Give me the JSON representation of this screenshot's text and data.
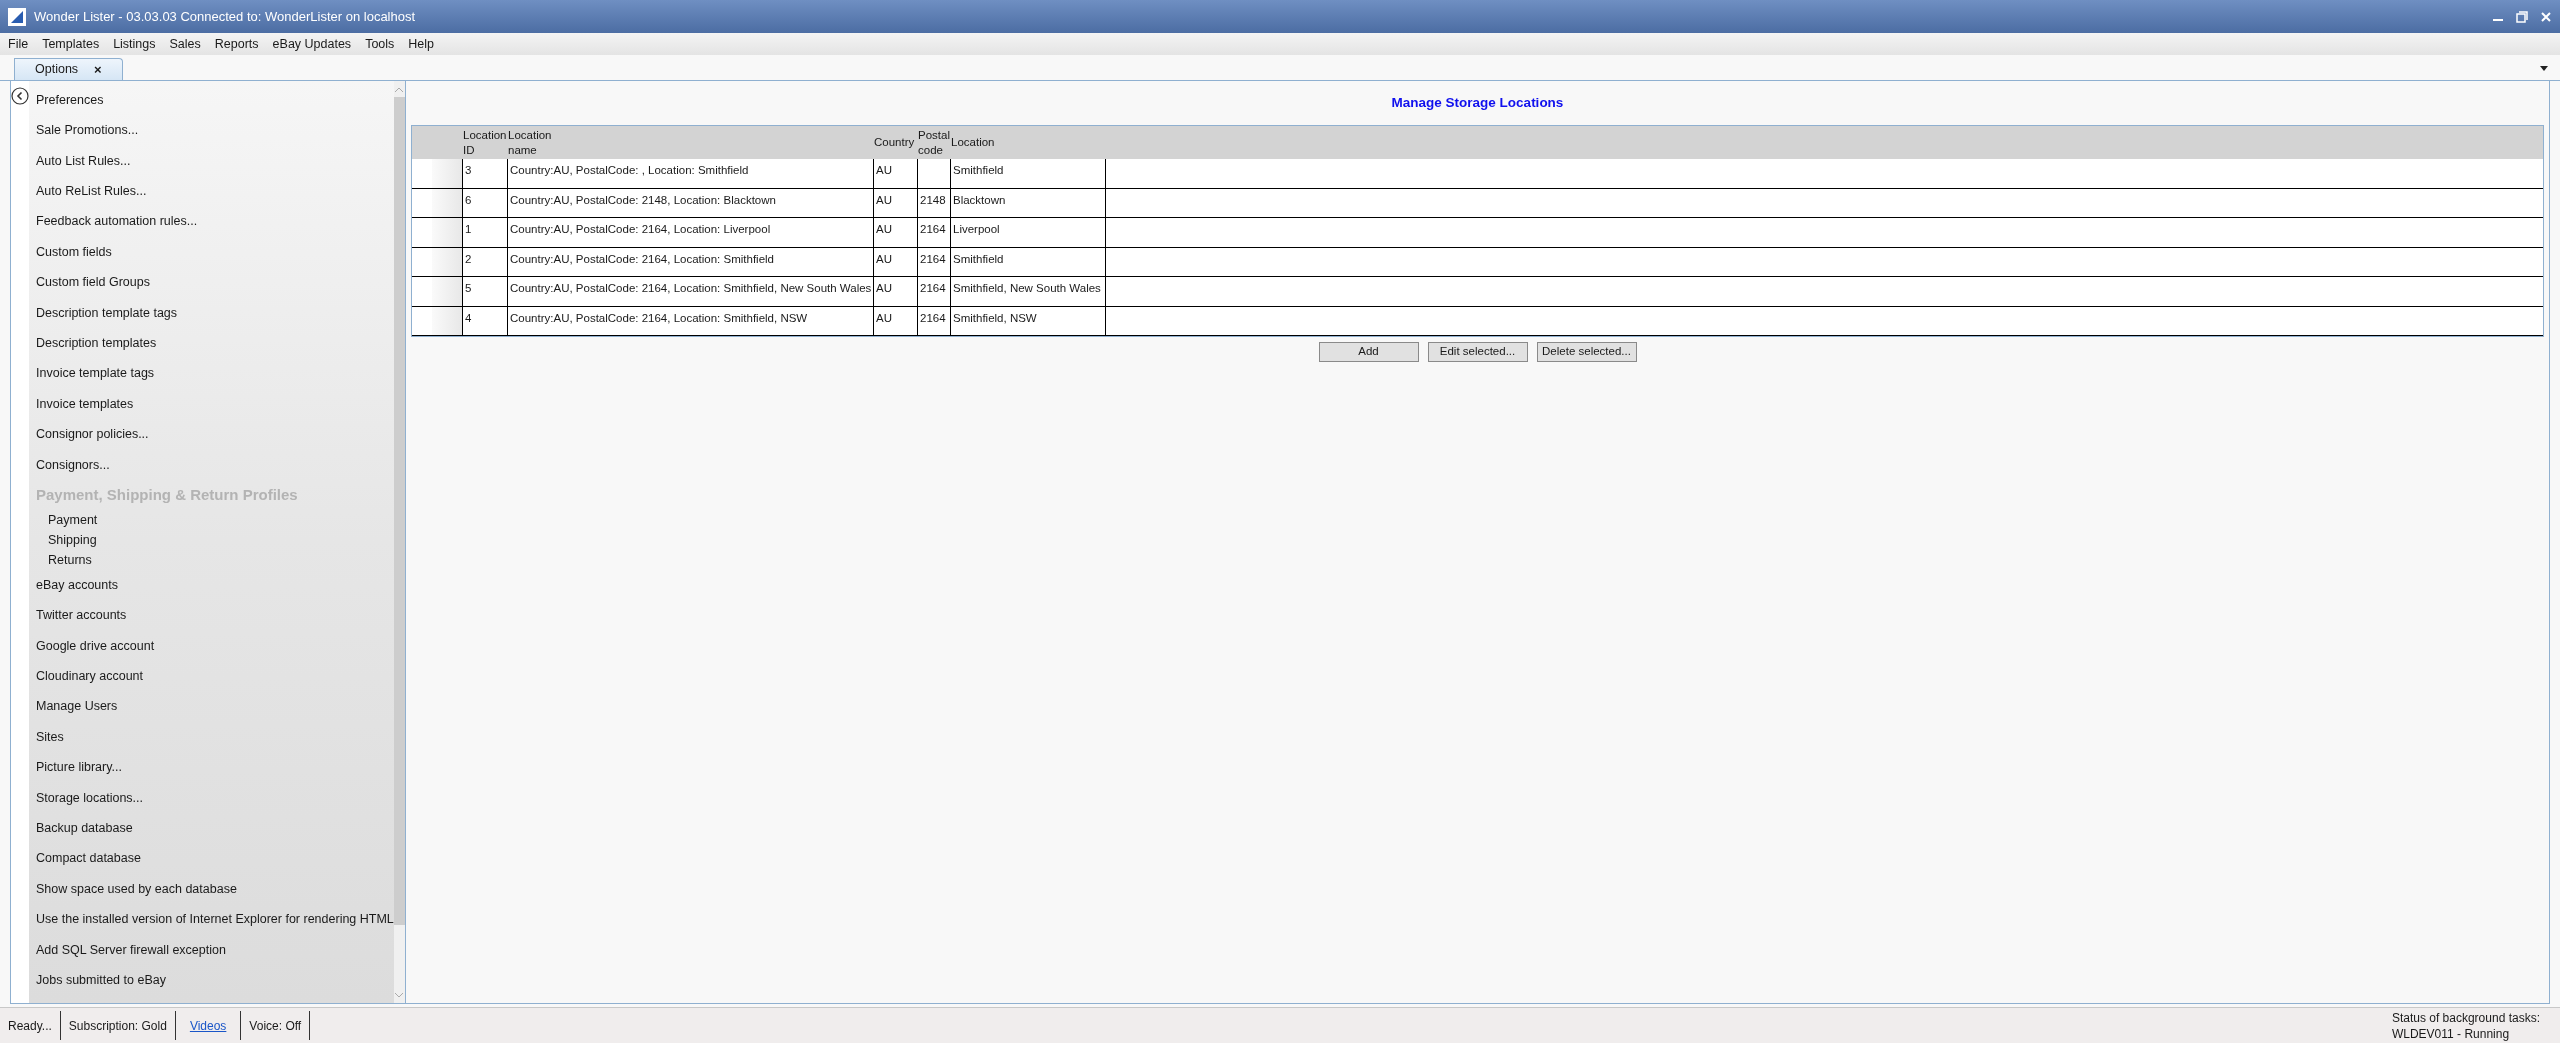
{
  "window": {
    "title": "Wonder Lister - 03.03.03 Connected to: WonderLister on localhost"
  },
  "menu": [
    "File",
    "Templates",
    "Listings",
    "Sales",
    "Reports",
    "eBay Updates",
    "Tools",
    "Help"
  ],
  "tabs": [
    {
      "label": "Options",
      "selected": true,
      "close": "×"
    }
  ],
  "sidebar": {
    "items": [
      {
        "kind": "item",
        "label": "Preferences"
      },
      {
        "kind": "item",
        "label": "Sale Promotions..."
      },
      {
        "kind": "item",
        "label": "Auto List Rules..."
      },
      {
        "kind": "item",
        "label": "Auto ReList Rules..."
      },
      {
        "kind": "item",
        "label": "Feedback automation rules..."
      },
      {
        "kind": "item",
        "label": "Custom fields"
      },
      {
        "kind": "item",
        "label": "Custom field Groups"
      },
      {
        "kind": "item",
        "label": "Description template tags"
      },
      {
        "kind": "item",
        "label": "Description templates"
      },
      {
        "kind": "item",
        "label": "Invoice template tags"
      },
      {
        "kind": "item",
        "label": "Invoice templates"
      },
      {
        "kind": "item",
        "label": "Consignor policies..."
      },
      {
        "kind": "item",
        "label": "Consignors..."
      },
      {
        "kind": "heading",
        "label": "Payment, Shipping & Return Profiles"
      },
      {
        "kind": "subitem",
        "label": "Payment"
      },
      {
        "kind": "subitem",
        "label": "Shipping"
      },
      {
        "kind": "subitem",
        "label": "Returns"
      },
      {
        "kind": "item",
        "label": "eBay accounts"
      },
      {
        "kind": "item",
        "label": "Twitter accounts"
      },
      {
        "kind": "item",
        "label": "Google drive account"
      },
      {
        "kind": "item",
        "label": "Cloudinary account"
      },
      {
        "kind": "item",
        "label": "Manage Users"
      },
      {
        "kind": "item",
        "label": "Sites"
      },
      {
        "kind": "item",
        "label": "Picture library..."
      },
      {
        "kind": "item",
        "label": "Storage locations..."
      },
      {
        "kind": "item",
        "label": "Backup database"
      },
      {
        "kind": "item",
        "label": "Compact database"
      },
      {
        "kind": "item",
        "label": "Show space used by each database"
      },
      {
        "kind": "item",
        "label": "Use the installed version of Internet Explorer for rendering HTML"
      },
      {
        "kind": "item",
        "label": "Add SQL Server firewall exception"
      },
      {
        "kind": "item",
        "label": "Jobs submitted to eBay"
      }
    ]
  },
  "main": {
    "title": "Manage Storage Locations"
  },
  "table": {
    "columns": [
      "Location ID",
      "Location name",
      "Country",
      "Postal code",
      "Location"
    ],
    "rows": [
      [
        "3",
        "Country:AU, PostalCode: , Location: Smithfield",
        "AU",
        "",
        "Smithfield"
      ],
      [
        "6",
        "Country:AU, PostalCode: 2148, Location: Blacktown",
        "AU",
        "2148",
        "Blacktown"
      ],
      [
        "1",
        "Country:AU, PostalCode: 2164, Location: Liverpool",
        "AU",
        "2164",
        "Liverpool"
      ],
      [
        "2",
        "Country:AU, PostalCode: 2164, Location: Smithfield",
        "AU",
        "2164",
        "Smithfield"
      ],
      [
        "5",
        "Country:AU, PostalCode: 2164, Location: Smithfield, New South Wales",
        "AU",
        "2164",
        "Smithfield, New South Wales"
      ],
      [
        "4",
        "Country:AU, PostalCode: 2164, Location: Smithfield, NSW",
        "AU",
        "2164",
        "Smithfield, NSW"
      ]
    ]
  },
  "buttons": [
    "Add",
    "Edit selected...",
    "Delete selected..."
  ],
  "status_bar": {
    "items": [
      {
        "kind": "text",
        "text": "Ready..."
      },
      {
        "kind": "text",
        "text": "Subscription: Gold"
      },
      {
        "kind": "link",
        "text": "Videos"
      },
      {
        "kind": "text",
        "text": "Voice:  Off"
      }
    ],
    "background": [
      "Status of background tasks:",
      "WLDEV011 - Running"
    ]
  }
}
